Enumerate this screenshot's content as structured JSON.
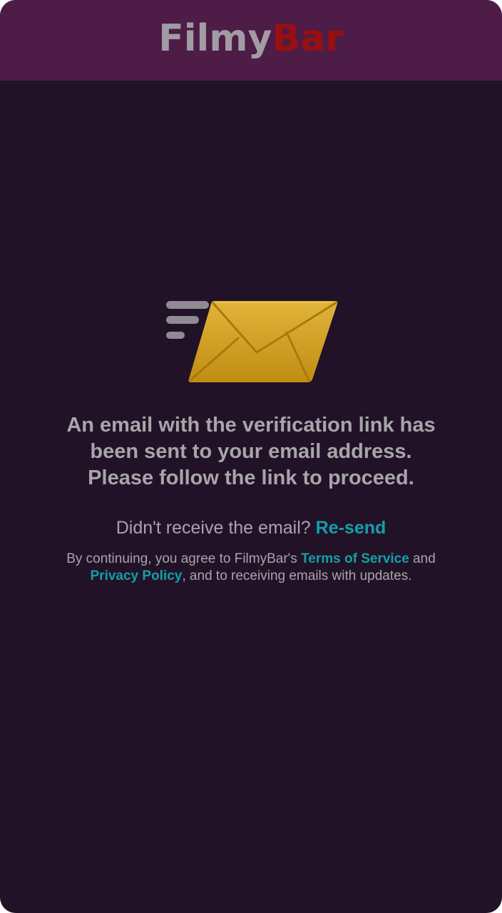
{
  "header": {
    "logo_part1": "Filmy",
    "logo_part2": "Bar",
    "background_color": "#4d1c47",
    "logo_part1_color": "#a19ca3",
    "logo_part2_color": "#9b0e10"
  },
  "main": {
    "illustration_icon": "envelope-sending-icon",
    "message_lines": [
      "An email with the verification link has",
      "been sent to your email address.",
      "Please follow the link to proceed."
    ],
    "resend_prompt": "Didn't receive the email?",
    "resend_label": "Re-send",
    "legal": {
      "prefix": "By continuing, you agree to FilmyBar's",
      "terms_label": "Terms of Service",
      "and_text": "and",
      "privacy_label": "Privacy Policy",
      "suffix": ", and to receiving emails with updates."
    }
  },
  "colors": {
    "background": "#221227",
    "text": "#a8a5aa",
    "link": "#12a0a7",
    "envelope": "#d4a21f"
  }
}
